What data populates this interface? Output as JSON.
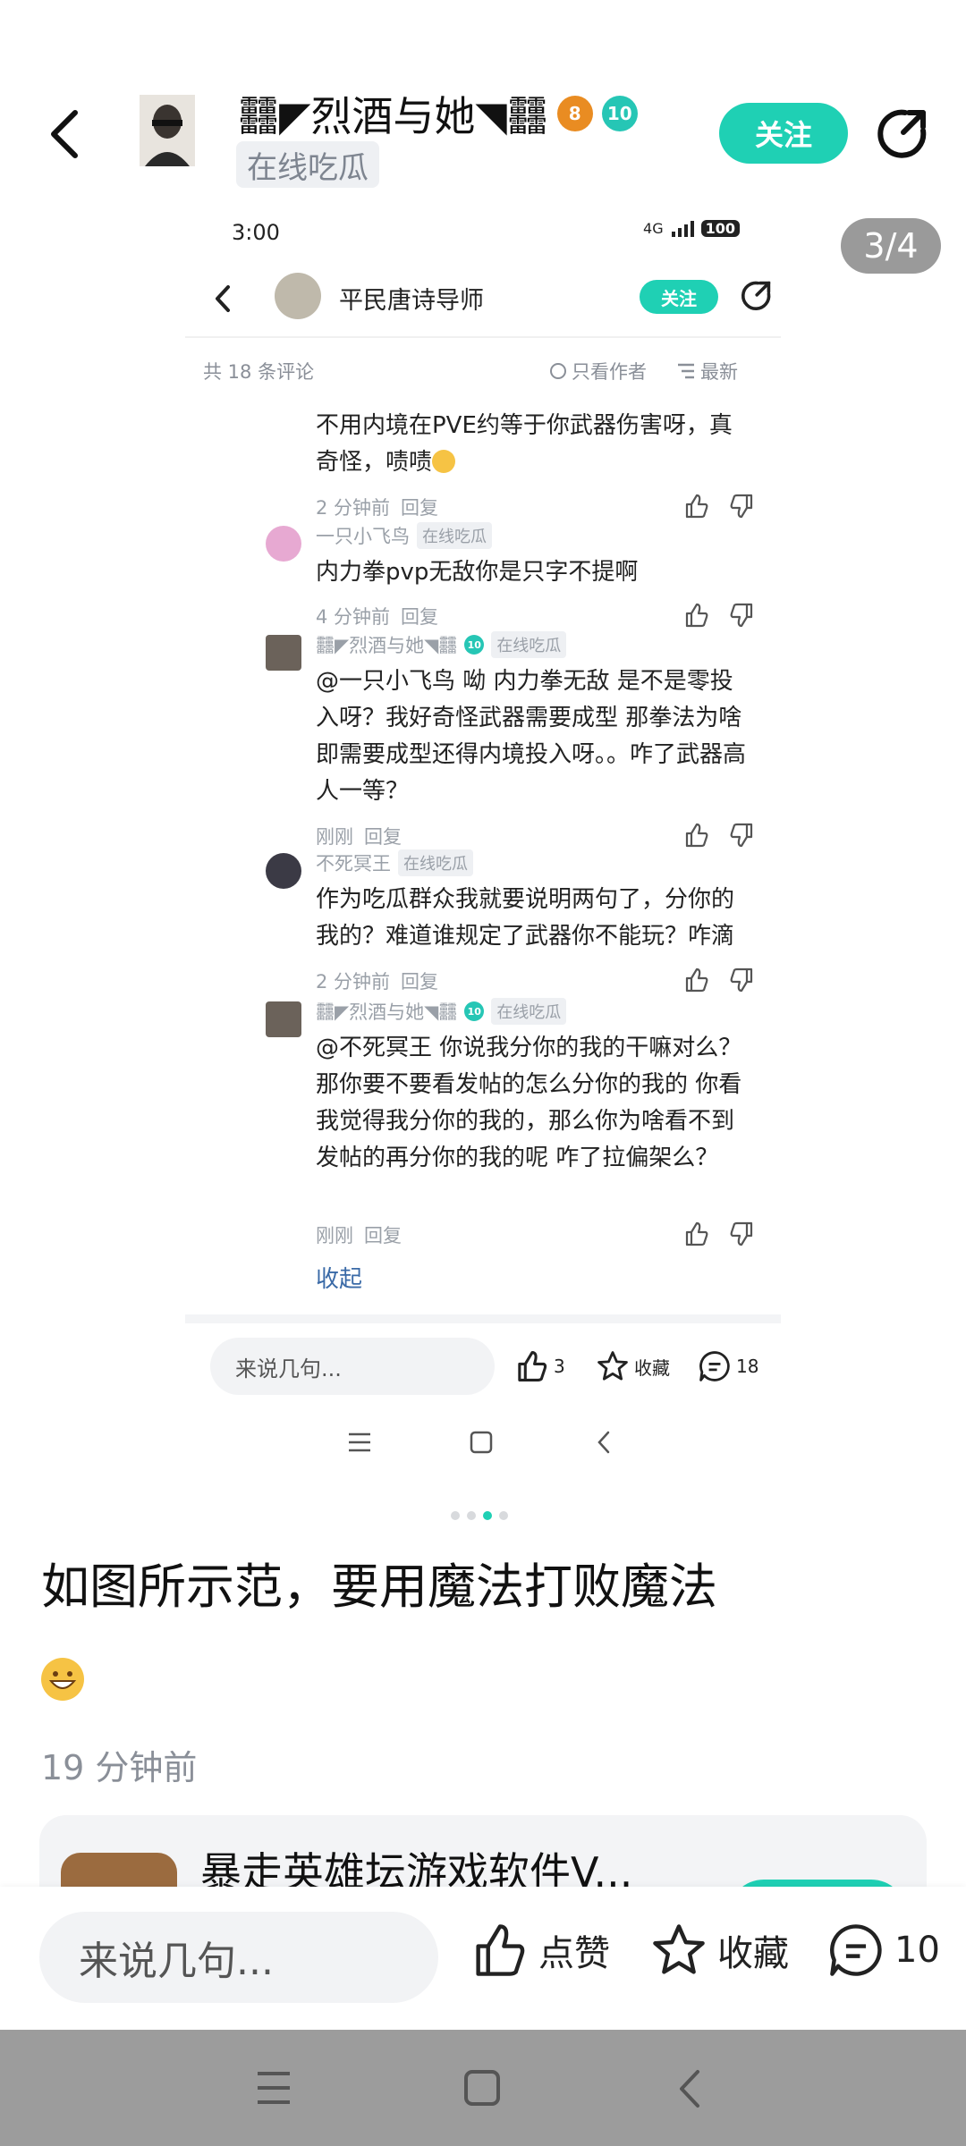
{
  "header": {
    "author_name": "䨻◤烈酒与她◥䨻",
    "badge_orange": "8",
    "badge_teal": "10",
    "author_tag": "在线吃瓜",
    "follow_label": "关注"
  },
  "gallery": {
    "counter": "3/4",
    "active_index": 3,
    "total": 4
  },
  "shot": {
    "status_time": "3:00",
    "status_net": "4G",
    "battery": "100",
    "name": "平民唐诗导师",
    "follow_label": "关注",
    "comment_count_label": "共 18 条评论",
    "only_author_label": "只看作者",
    "newest_label": "最新",
    "comments": [
      {
        "text": "不用内境在PVE约等于你武器伤害呀，真奇怪，啧啧",
        "time": "2 分钟前",
        "reply": "回复"
      },
      {
        "user": "一只小飞鸟",
        "tag": "在线吃瓜",
        "text": "内力拳pvp无敌你是只字不提啊",
        "time": "4 分钟前",
        "reply": "回复"
      },
      {
        "user": "䨻◤烈酒与她◥䨻",
        "tag": "在线吃瓜",
        "text": "@一只小飞鸟  呦 内力拳无敌 是不是零投入呀？我好奇怪武器需要成型 那拳法为啥即需要成型还得内境投入呀。。咋了武器高人一等？",
        "time": "刚刚",
        "reply": "回复"
      },
      {
        "user": "不死冥王",
        "tag": "在线吃瓜",
        "text": "作为吃瓜群众我就要说明两句了，分你的我的？难道谁规定了武器你不能玩？咋滴",
        "time": "2 分钟前",
        "reply": "回复"
      },
      {
        "user": "䨻◤烈酒与她◥䨻",
        "tag": "在线吃瓜",
        "text": "@不死冥王  你说我分你的我的干嘛对么？那你要不要看发帖的怎么分你的我的 你看我觉得我分你的我的，那么你为啥看不到发帖的再分你的我的呢 咋了拉偏架么？",
        "time": "刚刚",
        "reply": "回复"
      }
    ],
    "collapse_label": "收起",
    "input_placeholder": "来说几句...",
    "like_count": "3",
    "favorite_label": "收藏",
    "comment_count": "18"
  },
  "post": {
    "title": "如图所示范，要用魔法打败魔法",
    "time": "19 分钟前"
  },
  "game_card": {
    "title": "暴走英雄坛游戏软件V..."
  },
  "bottom_bar": {
    "input_placeholder": "来说几句...",
    "like_label": "点赞",
    "favorite_label": "收藏",
    "comment_count": "10"
  },
  "colors": {
    "accent": "#1fd0b4",
    "nav_bar": "#9c9c9c"
  }
}
